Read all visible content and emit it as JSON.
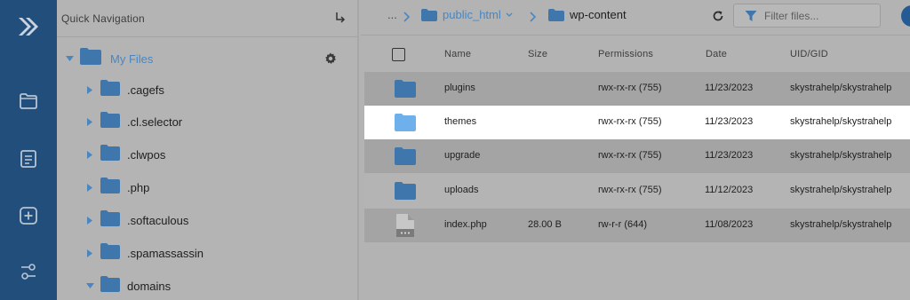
{
  "rail": {
    "icons": [
      "logo-chevrons-icon",
      "folder-icon",
      "document-icon",
      "plus-square-icon",
      "settings-sliders-icon"
    ]
  },
  "nav": {
    "title": "Quick Navigation",
    "root_label": "My Files",
    "items": [
      {
        "label": ".cagefs"
      },
      {
        "label": ".cl.selector"
      },
      {
        "label": ".clwpos"
      },
      {
        "label": ".php"
      },
      {
        "label": ".softaculous"
      },
      {
        "label": ".spamassassin"
      },
      {
        "label": "domains"
      }
    ]
  },
  "breadcrumb": {
    "ellipsis": "...",
    "parent": "public_html",
    "current": "wp-content"
  },
  "search": {
    "placeholder": "Filter files..."
  },
  "table": {
    "columns": [
      "Name",
      "Size",
      "Permissions",
      "Date",
      "UID/GID"
    ],
    "rows": [
      {
        "name": "plugins",
        "size": "",
        "permissions": "rwx-rx-rx (755)",
        "date": "11/23/2023",
        "owner": "skystrahelp/skystrahelp",
        "type": "folder"
      },
      {
        "name": "themes",
        "size": "",
        "permissions": "rwx-rx-rx (755)",
        "date": "11/23/2023",
        "owner": "skystrahelp/skystrahelp",
        "type": "folder"
      },
      {
        "name": "upgrade",
        "size": "",
        "permissions": "rwx-rx-rx (755)",
        "date": "11/23/2023",
        "owner": "skystrahelp/skystrahelp",
        "type": "folder"
      },
      {
        "name": "uploads",
        "size": "",
        "permissions": "rwx-rx-rx (755)",
        "date": "11/12/2023",
        "owner": "skystrahelp/skystrahelp",
        "type": "folder"
      },
      {
        "name": "index.php",
        "size": "28.00 B",
        "permissions": "rw-r-r (644)",
        "date": "11/08/2023",
        "owner": "skystrahelp/skystrahelp",
        "type": "file"
      }
    ]
  },
  "colors": {
    "rail": "#224e7c",
    "accent": "#4a86bf",
    "folder": "#3f76ab",
    "folder_selected": "#6db0ec",
    "selected_row": "#ffffff"
  }
}
